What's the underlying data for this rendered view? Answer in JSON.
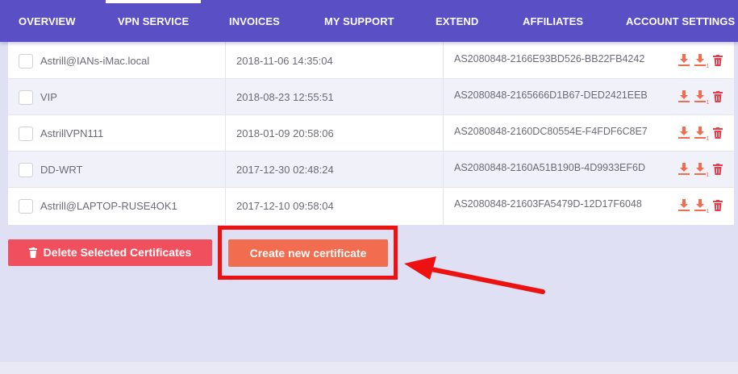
{
  "nav": {
    "items": [
      {
        "label": "OVERVIEW"
      },
      {
        "label": "VPN SERVICE"
      },
      {
        "label": "INVOICES"
      },
      {
        "label": "MY SUPPORT"
      },
      {
        "label": "EXTEND"
      },
      {
        "label": "AFFILIATES"
      },
      {
        "label": "ACCOUNT SETTINGS"
      }
    ],
    "active": "VPN SERVICE"
  },
  "certificates": [
    {
      "name": "Astrill@IANs-iMac.local",
      "date": "2018-11-06 14:35:04",
      "id": "AS2080848-2166E93BD526-BB22FB4242"
    },
    {
      "name": "VIP",
      "date": "2018-08-23 12:55:51",
      "id": "AS2080848-2165666D1B67-DED2421EEB"
    },
    {
      "name": "AstrillVPN111",
      "date": "2018-01-09 20:58:06",
      "id": "AS2080848-2160DC80554E-F4FDF6C8E7"
    },
    {
      "name": "DD-WRT",
      "date": "2017-12-30 02:48:24",
      "id": "AS2080848-2160A51B190B-4D9933EF6D"
    },
    {
      "name": "Astrill@LAPTOP-RUSE4OK1",
      "date": "2017-12-10 09:58:04",
      "id": "AS2080848-21603FA5479D-12D17F6048"
    }
  ],
  "row_actions": [
    {
      "icon": "download-icon"
    },
    {
      "icon": "download-alt-icon",
      "label": "1"
    },
    {
      "icon": "trash-icon"
    }
  ],
  "buttons": {
    "delete_label": "Delete Selected Certificates",
    "create_label": "Create new certificate"
  },
  "colors": {
    "nav_bg": "#5a4fc4",
    "delete_button": "#f0505e",
    "create_button": "#f26c4f",
    "action_icon": "#f26c4f",
    "trash_icon": "#e83c4b",
    "annotation": "#ee1111"
  }
}
